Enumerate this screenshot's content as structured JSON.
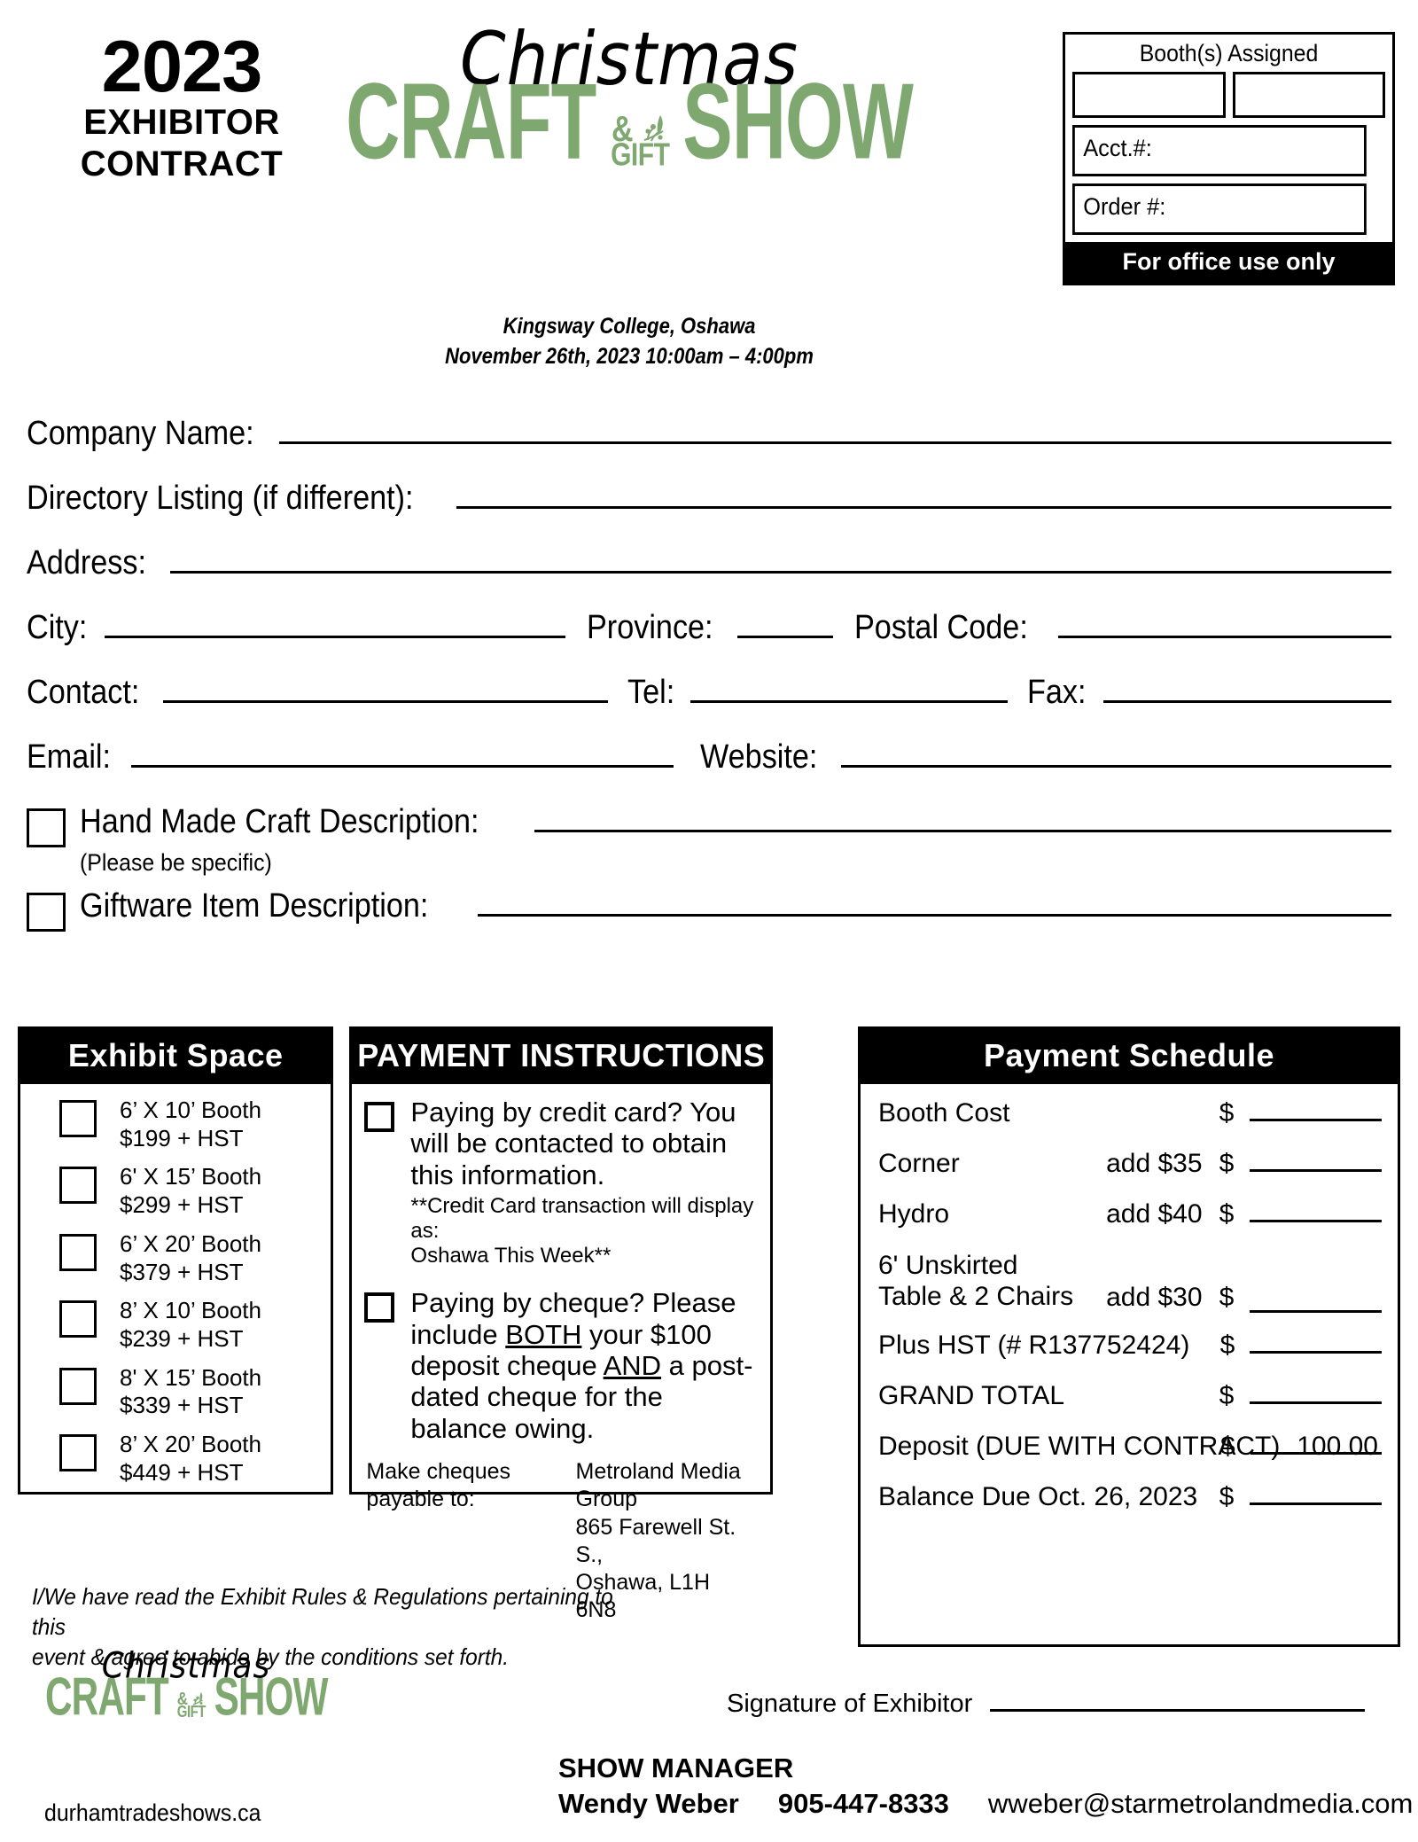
{
  "header": {
    "year": "2023",
    "line2": "EXHIBITOR",
    "line3": "CONTRACT",
    "logo": {
      "script": "Christmas",
      "craft": "CRAFT",
      "amp": "&",
      "gift": "GIFT",
      "show": "SHOW"
    },
    "venue_line1": "Kingsway College, Oshawa",
    "venue_line2": "November 26th, 2023 10:00am – 4:00pm",
    "office": {
      "booths_title": "Booth(s) Assigned",
      "acct_label": "Acct.#:",
      "order_label": "Order #:",
      "footer": "For office use only"
    }
  },
  "form": {
    "company_name": "Company Name:",
    "directory_listing": "Directory Listing (if different):",
    "address": "Address:",
    "city": "City:",
    "province": "Province:",
    "postal_code": "Postal Code:",
    "contact": "Contact:",
    "tel": "Tel:",
    "fax": "Fax:",
    "email": "Email:",
    "website": "Website:",
    "hand_made": "Hand Made Craft Description:",
    "be_specific": "(Please be specific)",
    "giftware": "Giftware Item Description:"
  },
  "exhibit_space": {
    "title": "Exhibit Space",
    "options": [
      {
        "size": "6’ X 10’ Booth",
        "price": "$199 + HST"
      },
      {
        "size": "6' X 15’ Booth",
        "price": "$299 + HST"
      },
      {
        "size": "6’ X 20’ Booth",
        "price": "$379 + HST"
      },
      {
        "size": "8’ X 10’ Booth",
        "price": "$239 + HST"
      },
      {
        "size": "8' X 15’ Booth",
        "price": "$339 + HST"
      },
      {
        "size": "8’ X 20’ Booth",
        "price": "$449 + HST"
      }
    ]
  },
  "payment_instructions": {
    "title": "PAYMENT INSTRUCTIONS",
    "credit_card": "Paying by credit card? You will be contacted to obtain this information.",
    "credit_card_note_1": "**Credit Card transaction will display as:",
    "credit_card_note_2": "Oshawa This Week**",
    "cheque_pre": "Paying by cheque? Please include ",
    "cheque_both": "BOTH",
    "cheque_mid": " your $100 deposit cheque ",
    "cheque_and": "AND",
    "cheque_post": " a post-dated cheque for the balance owing.",
    "payable_label": "Make cheques payable to:",
    "payable_line1": "Metroland Media Group",
    "payable_line2": "865 Farewell St. S.,",
    "payable_line3": "Oshawa, L1H 6N8"
  },
  "payment_schedule": {
    "title": "Payment Schedule",
    "rows": [
      {
        "label": "Booth Cost",
        "add": "",
        "dollar": "$",
        "value": ""
      },
      {
        "label": "Corner",
        "add": "add $35",
        "dollar": "$",
        "value": ""
      },
      {
        "label": "Hydro",
        "add": "add $40",
        "dollar": "$",
        "value": ""
      },
      {
        "label": "6' Unskirted",
        "label2": "Table & 2 Chairs",
        "add": "add $30",
        "dollar": "$",
        "value": ""
      },
      {
        "label": "Plus HST (# R137752424)",
        "add": "",
        "dollar": "$",
        "value": ""
      },
      {
        "label": "GRAND TOTAL",
        "add": "",
        "dollar": "$",
        "value": ""
      },
      {
        "label": "Deposit (DUE WITH CONTRACT)",
        "add": "",
        "dollar": "$",
        "value": "100.00"
      },
      {
        "label": "Balance Due Oct. 26, 2023",
        "add": "",
        "dollar": "$",
        "value": ""
      }
    ]
  },
  "footer": {
    "agreement_line1": "I/We have read the Exhibit Rules & Regulations pertaining to this",
    "agreement_line2": "event & agree to abide by the conditions set forth.",
    "website": "durhamtradeshows.ca",
    "signature_label": "Signature of Exhibitor",
    "show_manager_label": "SHOW MANAGER",
    "manager_name": "Wendy Weber",
    "manager_phone": "905-447-8333",
    "manager_email": "wweber@starmetrolandmedia.com"
  },
  "colors": {
    "brand_green": "#7FA871",
    "black": "#000000",
    "white": "#FFFFFF"
  }
}
